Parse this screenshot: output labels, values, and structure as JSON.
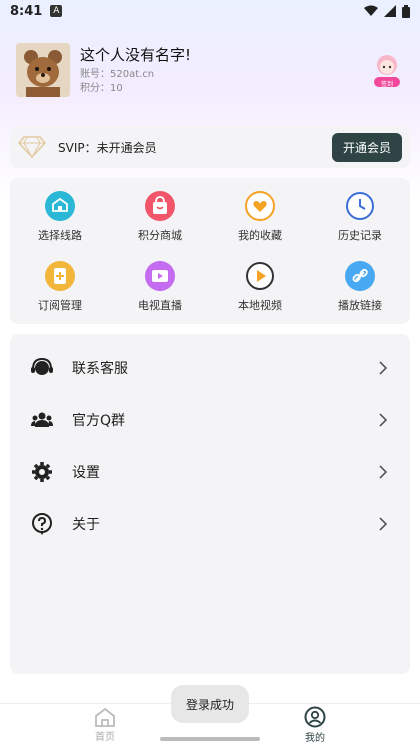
{
  "status": {
    "time": "8:41",
    "badge": "A"
  },
  "profile": {
    "nickname": "这个人没有名字!",
    "account": "账号：520at.cn",
    "points": "积分：10",
    "checkin_label": "签到"
  },
  "svip": {
    "status": "SVIP：未开通会员",
    "button": "开通会员"
  },
  "grid": [
    {
      "label": "选择线路",
      "icon": "route-icon",
      "color": "#2bb8d6"
    },
    {
      "label": "积分商城",
      "icon": "shop-bag-icon",
      "color": "#f0556a"
    },
    {
      "label": "我的收藏",
      "icon": "heart-icon",
      "color": "#f5a324"
    },
    {
      "label": "历史记录",
      "icon": "clock-icon",
      "color": "#3d6fd9"
    },
    {
      "label": "订阅管理",
      "icon": "subscribe-icon",
      "color": "#f2b63a"
    },
    {
      "label": "电视直播",
      "icon": "tv-icon",
      "color": "#c66cf0"
    },
    {
      "label": "本地视频",
      "icon": "play-icon",
      "color": "#333333"
    },
    {
      "label": "播放链接",
      "icon": "link-icon",
      "color": "#49a8f2"
    }
  ],
  "menu": [
    {
      "label": "联系客服",
      "icon": "headset-icon"
    },
    {
      "label": "官方Q群",
      "icon": "group-icon"
    },
    {
      "label": "设置",
      "icon": "gear-icon"
    },
    {
      "label": "关于",
      "icon": "question-icon"
    }
  ],
  "tabs": [
    {
      "label": "首页",
      "icon": "home-icon"
    },
    {
      "label": "我的",
      "icon": "profile-icon"
    }
  ],
  "toast": "登录成功"
}
